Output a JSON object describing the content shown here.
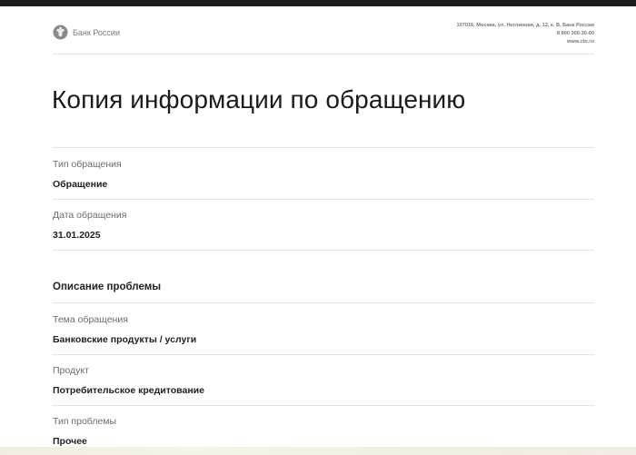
{
  "header": {
    "org_name": "Банк России",
    "address": "107016, Москва, ул. Неглинная, д. 12, к. В, Банк России",
    "phone": "8 800 300-30-00",
    "website": "www.cbr.ru"
  },
  "document": {
    "title": "Копия информации по обращению",
    "fields": [
      {
        "label": "Тип обращения",
        "value": "Обращение"
      },
      {
        "label": "Дата обращения",
        "value": "31.01.2025"
      }
    ],
    "section_title": "Описание проблемы",
    "problem_fields": [
      {
        "label": "Тема обращения",
        "value": "Банковские продукты / услуги"
      },
      {
        "label": "Продукт",
        "value": "Потребительское кредитование"
      },
      {
        "label": "Тип проблемы",
        "value": "Прочее"
      }
    ]
  }
}
